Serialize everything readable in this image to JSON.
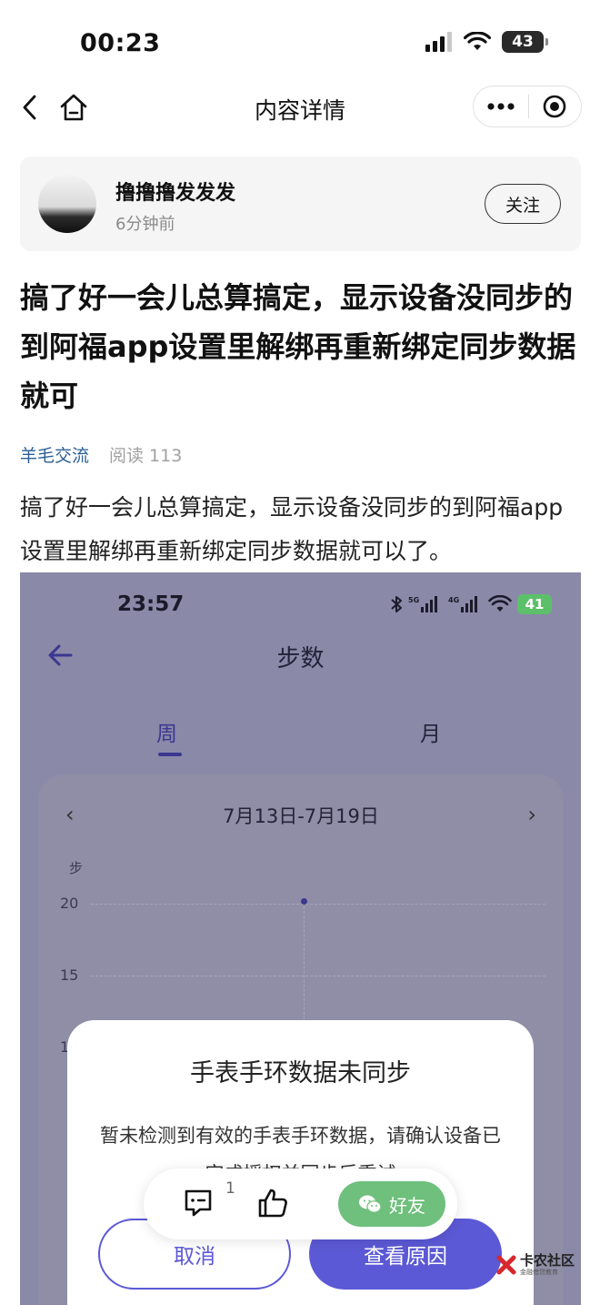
{
  "status_bar": {
    "time": "00:23",
    "battery": "43"
  },
  "nav": {
    "title": "内容详情"
  },
  "author": {
    "name": "撸撸撸发发发",
    "time": "6分钟前",
    "follow_label": "关注"
  },
  "post": {
    "title": "搞了好一会儿总算搞定，显示设备没同步的到阿福app设置里解绑再重新绑定同步数据就可",
    "category": "羊毛交流",
    "reads": "阅读 113",
    "body": "搞了好一会儿总算搞定，显示设备没同步的到阿福app设置里解绑再重新绑定同步数据就可以了。"
  },
  "screenshot": {
    "status_time": "23:57",
    "battery": "41",
    "title": "步数",
    "tab_week": "周",
    "tab_month": "月",
    "date_range": "7月13日-7月19日",
    "y_unit": "步",
    "y_ticks": [
      "20",
      "15",
      "1"
    ],
    "dialog": {
      "title": "手表手环数据未同步",
      "message": "暂未检测到有效的手表手环数据，请确认设备已完成授权并同步后重试",
      "cancel_label": "取消",
      "confirm_label": "查看原因"
    }
  },
  "actions": {
    "comment_count": "1",
    "share_label": "好友"
  },
  "watermark": {
    "main": "卡农社区",
    "sub": "金融借贷教育"
  },
  "colors": {
    "category_link": "#2c5f96",
    "dialog_accent": "#5c59d6",
    "share_green": "#6ec07c",
    "screenshot_overlay": "#8a89a8"
  }
}
